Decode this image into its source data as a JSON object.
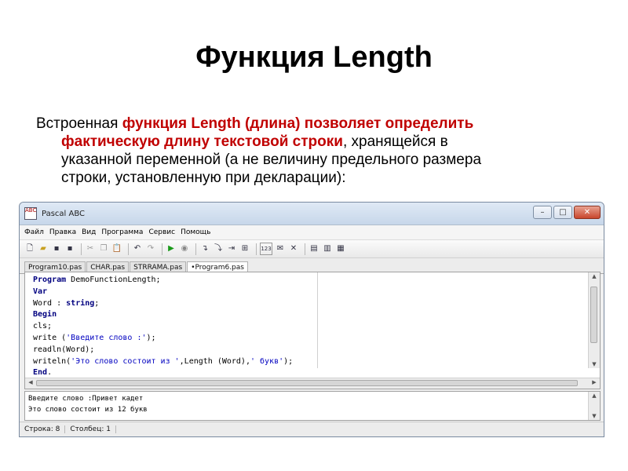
{
  "slide": {
    "title": "Функция Length",
    "intro": "Встроенная ",
    "highlight1": "функция Length (длина) позволяет определить",
    "highlight2": "фактическую длину текстовой строки",
    "rest1": ", хранящейся в",
    "line3": "указанной переменной (а не величину предельного размера",
    "line4": "строки, установленную при декларации):"
  },
  "window": {
    "title": "Pascal ABC",
    "icon_text": "ABC",
    "minimize": "–",
    "maximize": "□",
    "close": "✕"
  },
  "menu": [
    "Файл",
    "Правка",
    "Вид",
    "Программа",
    "Сервис",
    "Помощь"
  ],
  "toolbar_icons": [
    "new-file-icon",
    "open-icon",
    "save-icon",
    "save-all-icon",
    "cut-icon",
    "copy-icon",
    "paste-icon",
    "undo-icon",
    "redo-icon",
    "run-icon",
    "stop-icon",
    "step-into-icon",
    "step-over-icon",
    "run-to-cursor-icon",
    "breakpoint-icon",
    "watch-icon",
    "toggle-icon",
    "delete-icon",
    "window-1-icon",
    "window-2-icon",
    "window-3-icon"
  ],
  "tabs": [
    {
      "label": "Program10.pas",
      "active": false
    },
    {
      "label": "CHAR.pas",
      "active": false
    },
    {
      "label": "STRRAMA.pas",
      "active": false
    },
    {
      "label": "•Program6.pas",
      "active": true
    }
  ],
  "code": {
    "l1_kw": "Program",
    "l1_rest": " DemoFunctionLength;",
    "l2_kw": "Var",
    "l3_a": "Word : ",
    "l3_kw": "string",
    "l3_b": ";",
    "l4_kw": "Begin",
    "l5": "cls;",
    "l6_a": "write (",
    "l6_str": "'Введите слово :'",
    "l6_b": ");",
    "l7": "readln(Word);",
    "l8_a": "writeln(",
    "l8_str": "'Это слово состоит из '",
    "l8_b": ",Length (Word),",
    "l8_str2": "' букв'",
    "l8_c": ");",
    "l9_kw": "End",
    "l9_b": "."
  },
  "output": {
    "line1": "Введите слово :Привет кадет",
    "line2": "Это слово состоит из 12 букв"
  },
  "status": {
    "row": "Строка: 8",
    "col": "Столбец: 1"
  }
}
